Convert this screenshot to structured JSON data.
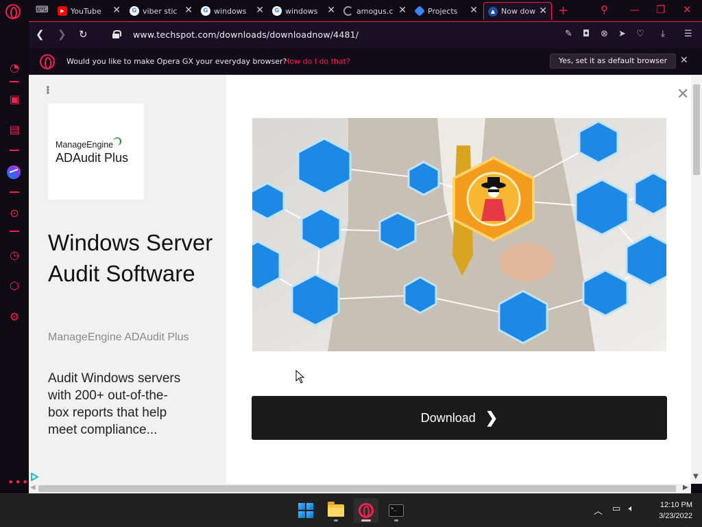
{
  "browser": {
    "tabs": [
      {
        "label": "YouTube",
        "favicon": "youtube-icon",
        "active": false
      },
      {
        "label": "viber stic",
        "favicon": "google-icon",
        "active": false
      },
      {
        "label": "windows",
        "favicon": "google-icon",
        "active": false
      },
      {
        "label": "windows",
        "favicon": "google-icon",
        "active": false
      },
      {
        "label": "amogus.c",
        "favicon": "loading-icon",
        "active": false
      },
      {
        "label": "Projects",
        "favicon": "cube-icon",
        "active": false
      },
      {
        "label": "Now dow",
        "favicon": "techspot-icon",
        "active": true
      }
    ],
    "url": "www.techspot.com/downloads/downloadnow/4481/",
    "accent_color": "#fa1e4e"
  },
  "notification": {
    "message": "Would you like to make Opera GX your everyday browser?",
    "link": "How do I do that?",
    "button": "Yes, set it as default browser"
  },
  "ad": {
    "logo_company": "ManageEngine",
    "logo_product": "ADAudit Plus",
    "headline": "Windows Server Audit Software",
    "subtitle": "ManageEngine ADAudit Plus",
    "description": "Audit Windows servers with 200+ out-of-the-box reports that help meet compliance..."
  },
  "main": {
    "download_button": "Download"
  },
  "taskbar": {
    "time": "12:10 PM",
    "date": "3/23/2022"
  }
}
